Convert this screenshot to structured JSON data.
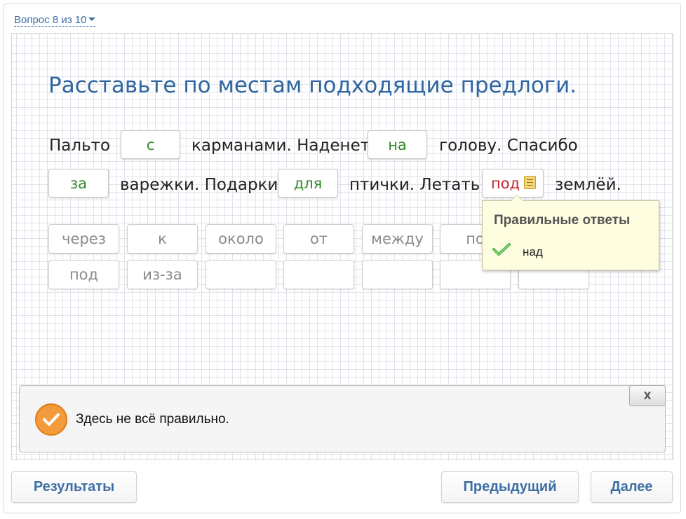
{
  "nav": {
    "question_label": "Вопрос 8 из 10"
  },
  "task": {
    "title": "Расставьте по местам подходящие предлоги.",
    "words": [
      "Пальто",
      "карманами. Наденет",
      "голову. Спасибо",
      "варежки. Подарки",
      "птички. Летать",
      "землёй."
    ],
    "slots": [
      {
        "value": "с",
        "status": "correct"
      },
      {
        "value": "на",
        "status": "correct"
      },
      {
        "value": "за",
        "status": "correct"
      },
      {
        "value": "для",
        "status": "correct"
      },
      {
        "value": "под",
        "status": "incorrect"
      }
    ]
  },
  "bank": {
    "row1": [
      "через",
      "к",
      "около",
      "от",
      "между",
      "по",
      ""
    ],
    "row2": [
      "под",
      "из-за",
      "",
      "",
      "",
      "",
      ""
    ]
  },
  "tooltip": {
    "title": "Правильные ответы",
    "answer": "над",
    "icon": "check-icon"
  },
  "feedback": {
    "text": "Здесь не всё правильно.",
    "close_label": "x",
    "icon": "warning-check-icon"
  },
  "buttons": {
    "results": "Результаты",
    "previous": "Предыдущий",
    "next": "Далее"
  },
  "colors": {
    "accent": "#3d6ea4",
    "title": "#2f65a0",
    "correct": "#2f8a2a",
    "incorrect": "#c0272d",
    "feedback_icon": "#f39a3b",
    "tooltip_bg": "#fffde0"
  }
}
